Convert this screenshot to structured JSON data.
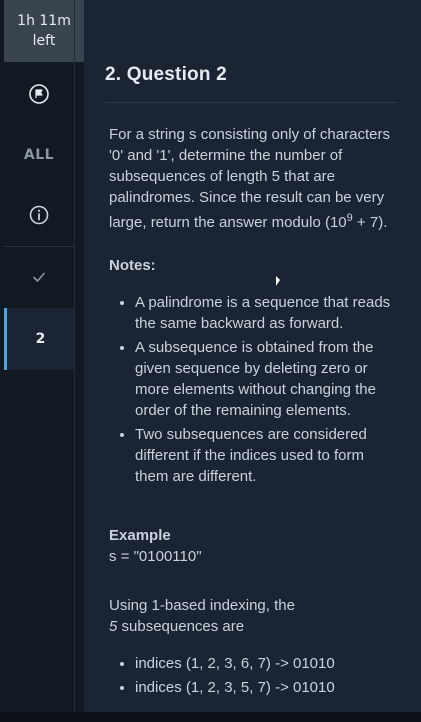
{
  "sidebar": {
    "timer_line1": "1h 11m",
    "timer_line2": "left",
    "all_label": "ALL",
    "active_question": "2",
    "icons": [
      "flag-icon",
      "info-icon",
      "check-icon"
    ]
  },
  "question": {
    "title": "2. Question 2",
    "intro_text": "For a string s consisting only of characters '0' and '1', determine the number of subsequences of length 5 that are palindromes. Since the result can be very large, return the answer modulo (10",
    "intro_exp": "9",
    "intro_tail": " + 7).",
    "notes_heading": "Notes:",
    "notes": [
      "A palindrome is a sequence that reads the same backward as forward.",
      "A subsequence is obtained from the given sequence by deleting zero or more elements without changing the order of the remaining elements.",
      "Two subsequences are considered different if the indices used to form them are different."
    ],
    "example_heading": "Example",
    "example_input": "s = \"0100110\"",
    "explain_line1": "Using 1-based indexing, the",
    "explain_count": "5",
    "explain_line2_tail": " subsequences are",
    "example_items": [
      "indices (1, 2, 3, 6, 7) -> 01010",
      "indices (1, 2, 3, 5, 7) -> 01010"
    ]
  }
}
